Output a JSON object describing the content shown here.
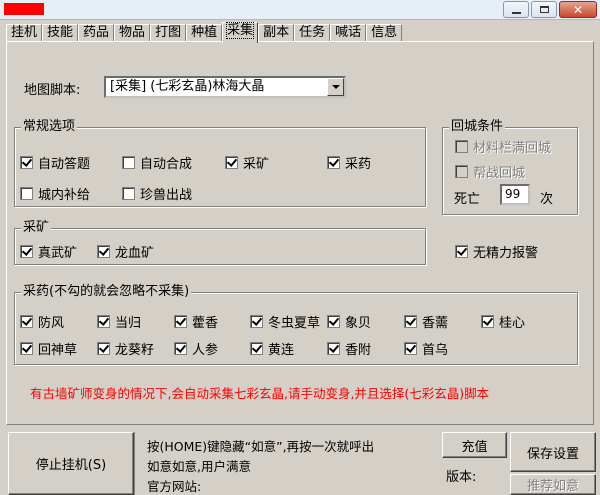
{
  "window": {
    "close_symbol": "✕"
  },
  "tabs": [
    "挂机",
    "技能",
    "药品",
    "物品",
    "打图",
    "种植",
    "采集",
    "副本",
    "任务",
    "喊话",
    "信息"
  ],
  "active_tab": "采集",
  "map": {
    "label": "地图脚本:",
    "selected": "[采集] (七彩玄晶)林海大晶"
  },
  "general": {
    "title": "常规选项",
    "auto_answer": {
      "label": "自动答题",
      "checked": true
    },
    "auto_compose": {
      "label": "自动合成",
      "checked": false
    },
    "mining": {
      "label": "采矿",
      "checked": true
    },
    "herb": {
      "label": "采药",
      "checked": true
    },
    "city_supply": {
      "label": "城内补给",
      "checked": false
    },
    "pet_fight": {
      "label": "珍兽出战",
      "checked": false
    }
  },
  "return_city": {
    "title": "回城条件",
    "bag_full": {
      "label": "材料栏满回城",
      "checked": false
    },
    "help_fight": {
      "label": "帮战回城",
      "checked": false
    },
    "death_label": "死亡",
    "death_count": "99",
    "death_unit": "次"
  },
  "mine": {
    "title": "采矿",
    "items": [
      {
        "label": "真武矿",
        "checked": true
      },
      {
        "label": "龙血矿",
        "checked": true
      }
    ]
  },
  "no_energy_alert": {
    "label": "无精力报警",
    "checked": true
  },
  "herbs": {
    "title": "采药(不勾的就会忽略不采集)",
    "row1": [
      {
        "label": "防风",
        "checked": true
      },
      {
        "label": "当归",
        "checked": true
      },
      {
        "label": "藿香",
        "checked": true
      },
      {
        "label": "冬虫夏草",
        "checked": true
      },
      {
        "label": "象贝",
        "checked": true
      },
      {
        "label": "香薷",
        "checked": true
      },
      {
        "label": "桂心",
        "checked": true
      }
    ],
    "row2": [
      {
        "label": "回神草",
        "checked": true
      },
      {
        "label": "龙葵籽",
        "checked": true
      },
      {
        "label": "人参",
        "checked": true
      },
      {
        "label": "黄连",
        "checked": true
      },
      {
        "label": "香附",
        "checked": true
      },
      {
        "label": "首乌",
        "checked": true
      }
    ]
  },
  "notice": "有古墙矿师变身的情况下,会自动采集七彩玄晶,请手动变身,并且选择(七彩玄晶)脚本",
  "bottom": {
    "stop_button": "停止挂机(S)",
    "info_line1": "按(HOME)键隐藏“如意”,再按一次就呼出",
    "info_line2": "如意如意,用户满意",
    "info_line3": "官方网站:",
    "recharge_button": "充值",
    "version_label": "版本:",
    "save_button": "保存设置",
    "recommend_button": "推荐如意"
  },
  "colors": {
    "notice": "#ff0000",
    "background": "#d4d0c8"
  }
}
